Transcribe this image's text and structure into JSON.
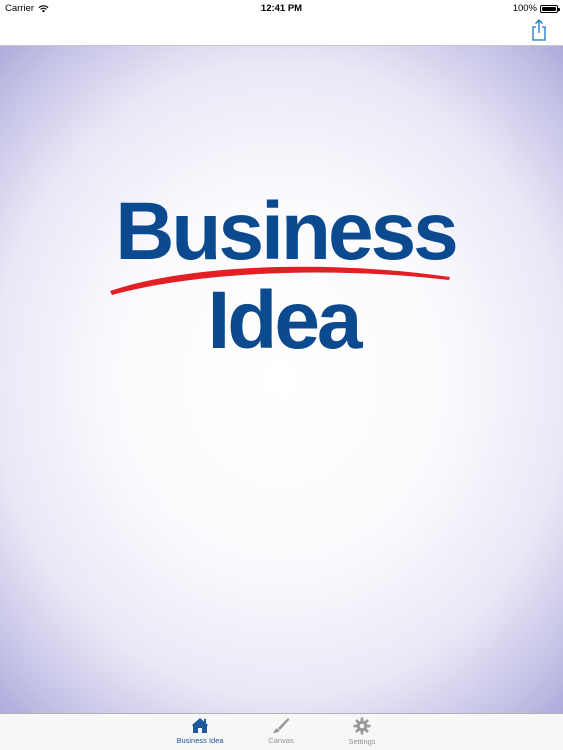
{
  "status_bar": {
    "carrier": "Carrier",
    "time": "12:41 PM",
    "battery": "100%",
    "battery_level": 1.0
  },
  "nav_bar": {
    "share_icon": "share-icon"
  },
  "logo": {
    "line1": "Business",
    "line2": "Idea",
    "text_color": "#0b4a8f",
    "swoosh_color": "#e31e24"
  },
  "tab_bar": {
    "tabs": [
      {
        "label": "Business Idea",
        "icon": "home-icon",
        "active": true
      },
      {
        "label": "Canvas",
        "icon": "brush-icon",
        "active": false
      },
      {
        "label": "Settings",
        "icon": "gear-icon",
        "active": false
      }
    ],
    "active_color": "#1a5a9a",
    "inactive_color": "#929292"
  }
}
